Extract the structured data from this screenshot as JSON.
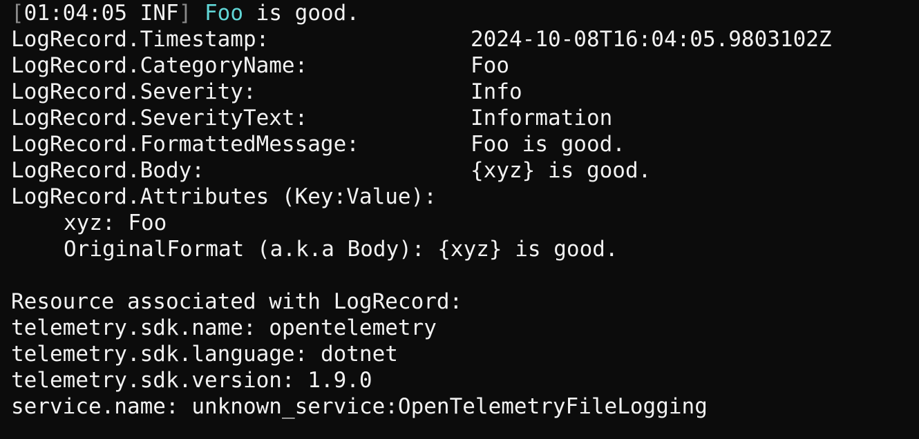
{
  "colors": {
    "background": "#0c0c0c",
    "foreground": "#f2f2f2",
    "bracket": "#8a8a8a",
    "category": "#61d6d6"
  },
  "header": {
    "open_bracket": "[",
    "time": "01:04:05",
    "level": "INF",
    "close_bracket": "]",
    "category": "Foo",
    "message": "is good."
  },
  "fields": [
    {
      "key": "LogRecord.Timestamp:",
      "value": "2024-10-08T16:04:05.9803102Z"
    },
    {
      "key": "LogRecord.CategoryName:",
      "value": "Foo"
    },
    {
      "key": "LogRecord.Severity:",
      "value": "Info"
    },
    {
      "key": "LogRecord.SeverityText:",
      "value": "Information"
    },
    {
      "key": "LogRecord.FormattedMessage:",
      "value": "Foo is good."
    },
    {
      "key": "LogRecord.Body:",
      "value": "{xyz} is good."
    }
  ],
  "attributes_header": "LogRecord.Attributes (Key:Value):",
  "attributes": [
    {
      "key": "xyz:",
      "value": "Foo"
    },
    {
      "key": "OriginalFormat (a.k.a Body):",
      "value": "{xyz} is good."
    }
  ],
  "resource_header": "Resource associated with LogRecord:",
  "resource": [
    {
      "key": "telemetry.sdk.name:",
      "value": "opentelemetry"
    },
    {
      "key": "telemetry.sdk.language:",
      "value": "dotnet"
    },
    {
      "key": "telemetry.sdk.version:",
      "value": "1.9.0"
    },
    {
      "key": "service.name:",
      "value": "unknown_service:OpenTelemetryFileLogging"
    }
  ]
}
